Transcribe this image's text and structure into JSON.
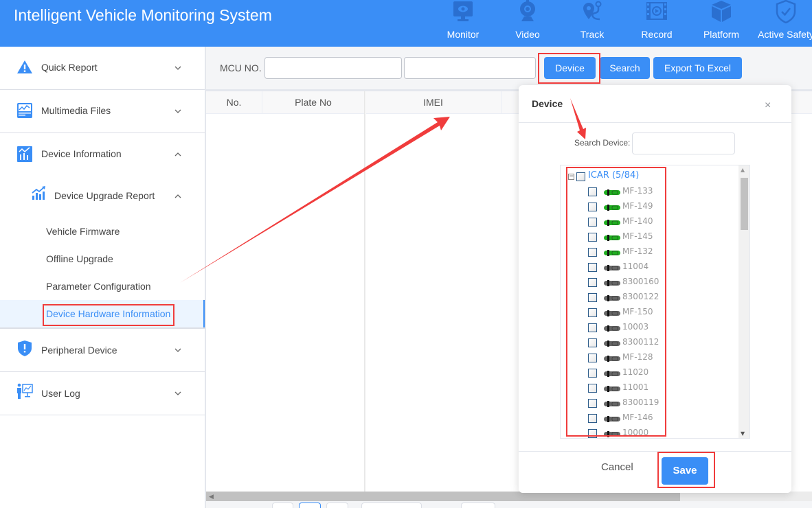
{
  "header": {
    "title": "Intelligent Vehicle Monitoring System",
    "nav": [
      {
        "label": "Monitor",
        "icon": "monitor-eye-icon"
      },
      {
        "label": "Video",
        "icon": "webcam-icon"
      },
      {
        "label": "Track",
        "icon": "route-pin-icon"
      },
      {
        "label": "Record",
        "icon": "film-replay-icon"
      },
      {
        "label": "Platform",
        "icon": "cube-icon"
      },
      {
        "label": "Active Safety",
        "icon": "shield-check-icon"
      }
    ]
  },
  "sidebar": {
    "items": [
      {
        "label": "Quick Report",
        "icon": "warning-icon",
        "expanded": false
      },
      {
        "label": "Multimedia Files",
        "icon": "image-chart-icon",
        "expanded": false
      },
      {
        "label": "Device Information",
        "icon": "bar-chart-icon",
        "expanded": true
      },
      {
        "label": "Peripheral Device",
        "icon": "shield-alert-icon",
        "expanded": false
      },
      {
        "label": "User Log",
        "icon": "presenter-icon",
        "expanded": false
      }
    ],
    "submenu": {
      "label": "Device Upgrade Report",
      "icon": "growth-chart-icon",
      "expanded": true,
      "items": [
        {
          "label": "Vehicle Firmware",
          "active": false
        },
        {
          "label": "Offline Upgrade",
          "active": false
        },
        {
          "label": "Parameter Configuration",
          "active": false
        },
        {
          "label": "Device Hardware Information",
          "active": true
        }
      ]
    }
  },
  "toolbar": {
    "mcu_label": "MCU NO.",
    "mcu_value": "",
    "second_value": "",
    "device_button": "Device",
    "search_button": "Search",
    "export_button": "Export To Excel"
  },
  "table": {
    "columns": [
      "No.",
      "Plate No",
      "IMEI"
    ],
    "rows": []
  },
  "dialog": {
    "title": "Device",
    "close": "×",
    "search_label": "Search Device:",
    "search_value": "",
    "tree": {
      "root_label": "ICAR (5/84)",
      "expander": "−",
      "items": [
        {
          "label": "MF-133",
          "online": true
        },
        {
          "label": "MF-149",
          "online": true
        },
        {
          "label": "MF-140",
          "online": true
        },
        {
          "label": "MF-145",
          "online": true
        },
        {
          "label": "MF-132",
          "online": true
        },
        {
          "label": "11004",
          "online": false
        },
        {
          "label": "8300160",
          "online": false
        },
        {
          "label": "8300122",
          "online": false
        },
        {
          "label": "MF-150",
          "online": false
        },
        {
          "label": "10003",
          "online": false
        },
        {
          "label": "8300112",
          "online": false
        },
        {
          "label": "MF-128",
          "online": false
        },
        {
          "label": "11020",
          "online": false
        },
        {
          "label": "11001",
          "online": false
        },
        {
          "label": "8300119",
          "online": false
        },
        {
          "label": "MF-146",
          "online": false
        },
        {
          "label": "10000",
          "online": false
        }
      ]
    },
    "cancel_label": "Cancel",
    "save_label": "Save"
  },
  "colors": {
    "brand": "#3a8ef6",
    "annotation": "#f03c3c",
    "online": "#1fae1f",
    "offline": "#666666"
  }
}
